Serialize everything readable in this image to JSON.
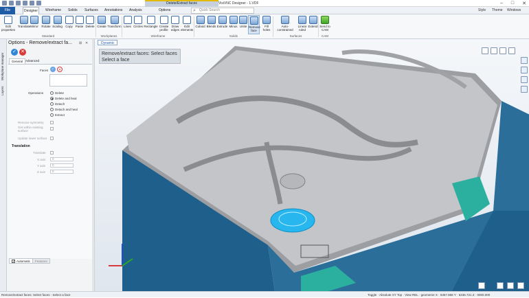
{
  "window": {
    "title": "VisiVNC Designer - 1.VDF",
    "context_tab": "Delete/Extract faces"
  },
  "menu": {
    "file": "File",
    "tabs": [
      "Designer",
      "Wireframe",
      "Solids",
      "Surfaces",
      "Annotations",
      "Analysis",
      "Options"
    ],
    "active": "Designer",
    "quick_search": "Quick Search",
    "right": [
      "Style",
      "Theme",
      "Windows"
    ]
  },
  "ribbon": {
    "buttons": [
      {
        "label": "Edit properties"
      },
      {
        "label": "Translate"
      },
      {
        "label": "Mirror"
      },
      {
        "label": "Rotate"
      },
      {
        "label": "Scaling"
      },
      {
        "label": "Copy"
      },
      {
        "label": "Paste"
      },
      {
        "label": "Delete"
      },
      {
        "label": "Create"
      },
      {
        "label": "Transform"
      },
      {
        "label": "Lines"
      },
      {
        "label": "Circles"
      },
      {
        "label": "Rectangle"
      },
      {
        "label": "Create profile"
      },
      {
        "label": "Draw edges"
      },
      {
        "label": "Edit elements"
      },
      {
        "label": "Cuboid"
      },
      {
        "label": "Blends"
      },
      {
        "label": "Extrude"
      },
      {
        "label": "Minus"
      },
      {
        "label": "Unite"
      },
      {
        "label": "Remove face"
      },
      {
        "label": "Fill holes"
      },
      {
        "label": "Auto-constrained"
      },
      {
        "label": "Linear ruled"
      },
      {
        "label": "Extend"
      },
      {
        "label": "Send to CAM"
      }
    ],
    "groups": [
      "Standard",
      "Workplanes",
      "Wireframe",
      "Solids",
      "Surfaces",
      "CAM"
    ]
  },
  "left_strip": {
    "labels": [
      "Workplane manager",
      "Layers"
    ]
  },
  "options_panel": {
    "title": "Options - Remove/extract fa...",
    "tabs": [
      "General",
      "Advanced"
    ],
    "faces_label": "Faces",
    "operations_label": "Operations",
    "operations": [
      "Delete",
      "Delete and heal",
      "Detach",
      "Detach and heal",
      "Extract"
    ],
    "operations_selected": 1,
    "options": [
      "Remove symmetry",
      "Get within existing surface",
      "Update lower surface"
    ],
    "translation_label": "Translation",
    "translation_field_label": "Translate",
    "axes": [
      {
        "label": "X axis",
        "value": "0"
      },
      {
        "label": "Y axis",
        "value": "0"
      },
      {
        "label": "Z axis",
        "value": "0"
      }
    ],
    "bottom_tabs": [
      "Automatic",
      "Features"
    ],
    "automatic_checked": true
  },
  "viewport": {
    "tab": "Dynamic",
    "prompt_line1": "Remove/extract faces: Select faces",
    "prompt_line2": "Select a face"
  },
  "status": {
    "left": "Remove/extract faces: Select faces - Select a face",
    "right": "Toggle  ·  Absolute XY Top  ·  View REL  ·  geomeme X · 6357.868 Y · 6236.721 Z · 0000.000"
  },
  "colors": {
    "accent": "#1f5ca6",
    "model_top": "#c4c6c9",
    "model_side": "#1f5f8b",
    "selection": "#27b6ee",
    "teal": "#2bb0a0"
  }
}
